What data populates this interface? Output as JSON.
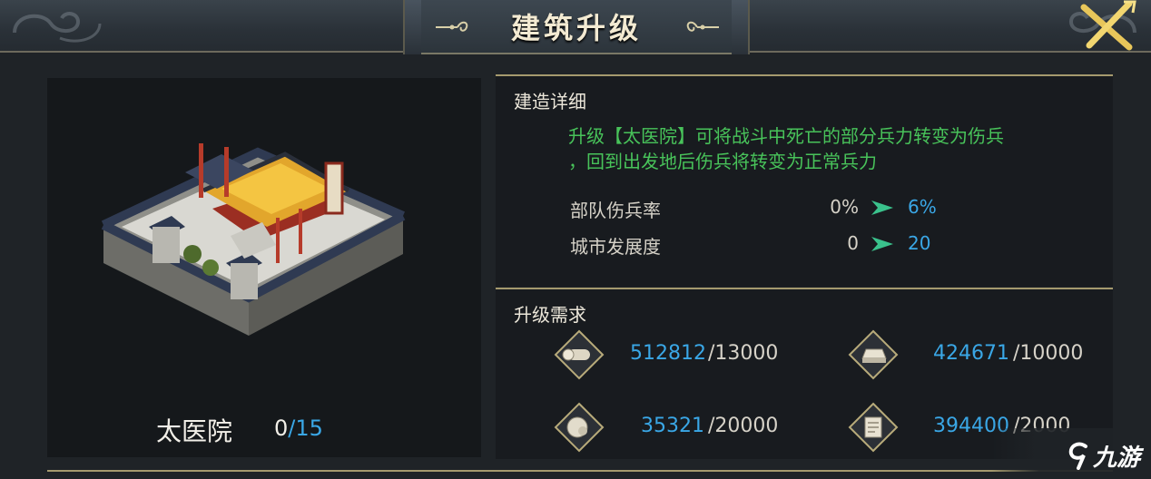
{
  "header": {
    "title": "建筑升级"
  },
  "building": {
    "name": "太医院",
    "level_current": "0",
    "level_max": "/15"
  },
  "detail": {
    "section_title": "建造详细",
    "description_line1": "升级【太医院】可将战斗中死亡的部分兵力转变为伤兵",
    "description_line2": "，回到出发地后伤兵将转变为正常兵力",
    "stats": [
      {
        "label": "部队伤兵率",
        "from": "0%",
        "to": "6%"
      },
      {
        "label": "城市发展度",
        "from": "0",
        "to": "20"
      }
    ]
  },
  "requirements": {
    "section_title": "升级需求",
    "items": [
      {
        "icon": "wood-log-icon",
        "have": "512812",
        "need": "/13000"
      },
      {
        "icon": "iron-ingot-icon",
        "have": "424671",
        "need": "/10000"
      },
      {
        "icon": "stone-ore-icon",
        "have": "35321",
        "need": "/20000"
      },
      {
        "icon": "scroll-icon",
        "have": "394400",
        "need": "/2000"
      }
    ]
  },
  "watermark": {
    "text": "九游"
  },
  "colors": {
    "accent_blue": "#3aa7e6",
    "desc_green": "#48c35a",
    "gold_border": "#a59a6e"
  }
}
